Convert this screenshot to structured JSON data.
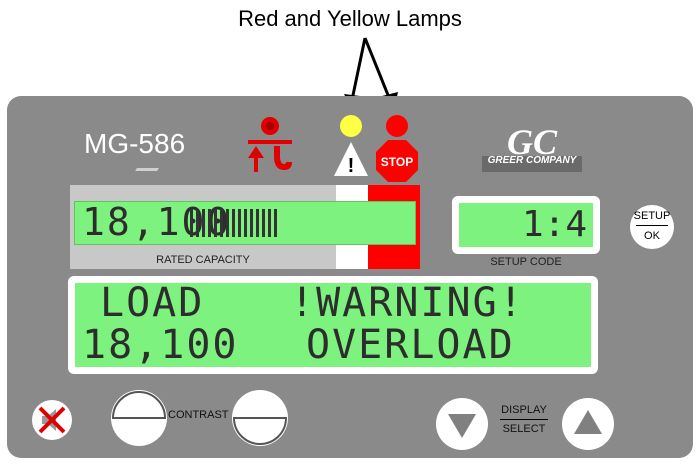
{
  "caption": "Red and Yellow Lamps",
  "panel": {
    "model": "MG-586",
    "logo": {
      "initials": "GC",
      "company": "GREER COMPANY"
    },
    "lamps": [
      {
        "name": "yellow-lamp",
        "color": "#ffff44",
        "symbol": "!"
      },
      {
        "name": "red-lamp",
        "color": "#ff0000",
        "symbol": "STOP"
      }
    ],
    "rated_capacity": {
      "value": "18,100",
      "label": "RATED CAPACITY",
      "bar_segments": 15
    },
    "setup_code": {
      "value": "1:4",
      "label": "SETUP CODE"
    },
    "main_display": {
      "line1_left": "LOAD",
      "line1_right": "!WARNING!",
      "line2_left": "18,100",
      "line2_right": "OVERLOAD"
    },
    "buttons": {
      "setup_top": "SETUP",
      "setup_bottom": "OK",
      "contrast": "CONTRAST",
      "display_top": "DISPLAY",
      "display_bottom": "SELECT"
    }
  },
  "colors": {
    "panel": "#8a8a8a",
    "lcd": "#7ef27e",
    "red": "#ff0000",
    "yellow": "#ffff44"
  }
}
